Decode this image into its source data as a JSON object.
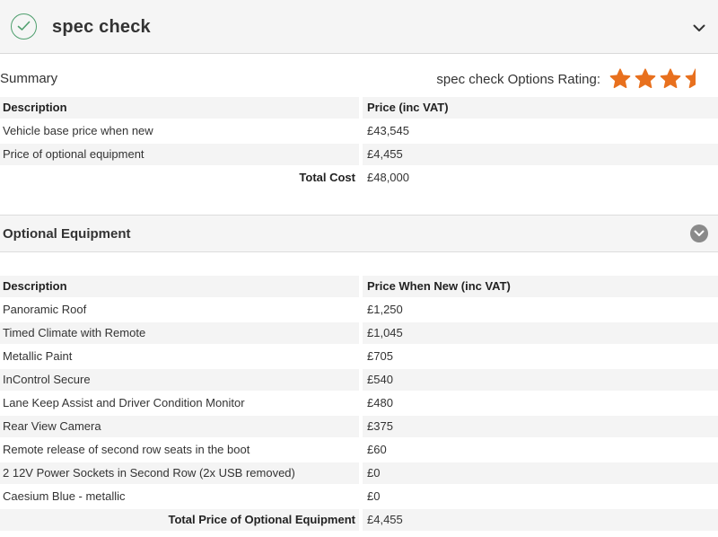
{
  "header": {
    "brand": "spec check"
  },
  "summary": {
    "label": "Summary",
    "rating_label": "spec check Options Rating:",
    "rating": 3.5,
    "rating_max": 5,
    "accent_color": "#e8701e",
    "columns": [
      "Description",
      "Price (inc VAT)"
    ],
    "rows": [
      {
        "desc": "Vehicle base price when new",
        "price": "£43,545"
      },
      {
        "desc": "Price of optional equipment",
        "price": "£4,455"
      }
    ],
    "total_label": "Total Cost",
    "total_value": "£48,000"
  },
  "optional": {
    "title": "Optional Equipment",
    "columns": [
      "Description",
      "Price When New (inc VAT)"
    ],
    "rows": [
      {
        "desc": "Panoramic Roof",
        "price": "£1,250"
      },
      {
        "desc": "Timed Climate with Remote",
        "price": "£1,045"
      },
      {
        "desc": "Metallic Paint",
        "price": "£705"
      },
      {
        "desc": "InControl Secure",
        "price": "£540"
      },
      {
        "desc": "Lane Keep Assist and Driver Condition Monitor",
        "price": "£480"
      },
      {
        "desc": "Rear View Camera",
        "price": "£375"
      },
      {
        "desc": "Remote release of second row seats in the boot",
        "price": "£60"
      },
      {
        "desc": "2 12V Power Sockets in Second Row (2x USB removed)",
        "price": "£0"
      },
      {
        "desc": "Caesium Blue - metallic",
        "price": "£0"
      }
    ],
    "total_label": "Total Price of Optional Equipment",
    "total_value": "£4,455"
  }
}
